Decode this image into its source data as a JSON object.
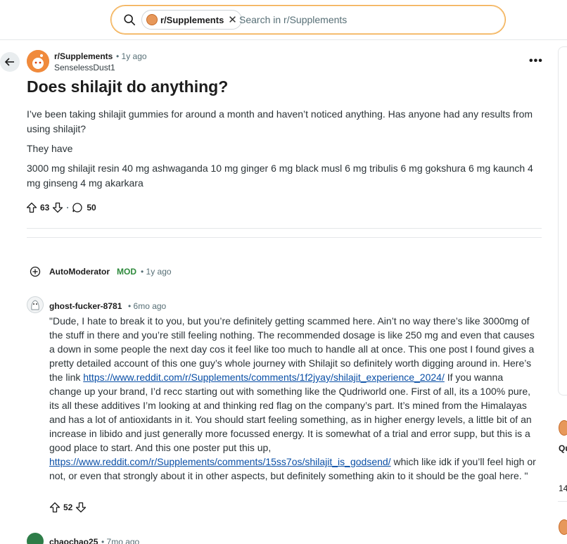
{
  "search": {
    "chip_label": "r/Supplements",
    "placeholder": "Search in r/Supplements"
  },
  "post": {
    "subreddit": "r/Supplements",
    "time": "• 1y ago",
    "author": "SenselessDust1",
    "title": "Does shilajit do anything?",
    "paragraphs": [
      "I’ve been taking shilajit gummies for around a month and haven’t noticed anything. Has anyone had any results from using shilajit?",
      "They have",
      "3000 mg shilajit resin 40 mg ashwaganda 10 mg ginger 6 mg black musl 6 mg tribulis 6 mg gokshura 6 mg kaunch 4 mg ginseng 4 mg akarkara"
    ],
    "upvotes": "63",
    "comments": "50"
  },
  "comments": {
    "automod": {
      "name": "AutoModerator",
      "badge": "MOD",
      "time": "• 1y ago"
    },
    "first": {
      "name": "ghost-fucker-8781",
      "time": "• 6mo ago",
      "text_1": "\"Dude, I hate to break it to you, but you’re definitely getting scammed here. Ain’t no way there’s like 3000mg of the stuff in there and you’re still feeling nothing. The recommended dosage is like 250 mg and even that causes a down in some people the next day cos it feel like too much to handle all at once. This one post I found gives a pretty detailed account of this one guy’s whole journey with Shilajit so definitely worth digging around in. Here’s the link ",
      "link_1": "https://www.reddit.com/r/Supplements/comments/1f2jyay/shilajit_experience_2024/",
      "text_2": " If you wanna change up your brand, I’d recc starting out with something like the Qudriworld one. First of all, its a 100% pure, its all these additives I’m looking at and thinking red flag on the company’s part. It’s mined from the Himalayas and has a lot of antioxidants in it. You should start feeling something, as in higher energy levels, a little bit of an increase in libido and just generally more focussed energy. It is somewhat of a trial and error supp, but this is a good place to start. And this one poster put this up, ",
      "link_2": "https://www.reddit.com/r/Supplements/comments/15ss7os/shilajit_is_godsend/",
      "text_3": " which like idk if you’ll feel high or not, or even that strongly about it in other aspects, but definitely something akin to it should be the goal here. \"",
      "upvotes": "52"
    },
    "second": {
      "name": "chaochao25",
      "time": "• 7mo ago"
    }
  },
  "right_edge": {
    "text_1": "Qu",
    "text_2": "14"
  },
  "colors": {
    "search_border": "#f2a33a",
    "link": "#0a4fa6",
    "mod_green": "#2e8a3c"
  },
  "icons": [
    "search-icon",
    "close-icon",
    "back-arrow-icon",
    "more-icon",
    "upvote-icon",
    "downvote-icon",
    "comment-icon",
    "expand-icon"
  ]
}
